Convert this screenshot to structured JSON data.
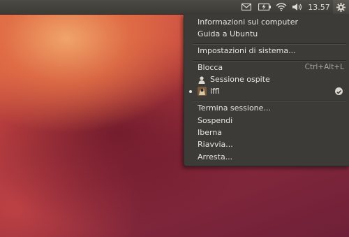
{
  "panel": {
    "clock": "13.57",
    "icons": [
      "mail-icon",
      "battery-icon",
      "wifi-icon",
      "volume-icon",
      "gear-icon"
    ]
  },
  "menu": {
    "about": "Informazioni sul computer",
    "help": "Guida a Ubuntu",
    "settings": "Impostazioni di sistema...",
    "lock": "Blocca",
    "lock_accel": "Ctrl+Alt+L",
    "guest": "Sessione ospite",
    "user": "lffl",
    "logout": "Termina sessione...",
    "suspend": "Sospendi",
    "hibernate": "Iberna",
    "restart": "Riavvia...",
    "shutdown": "Arresta..."
  },
  "colors": {
    "panel": "#3c3b37",
    "menu_bg": "#3c3b37",
    "menu_text": "#e8e5de",
    "wallpaper_orange": "#e06a48",
    "wallpaper_purple": "#6e2038"
  }
}
